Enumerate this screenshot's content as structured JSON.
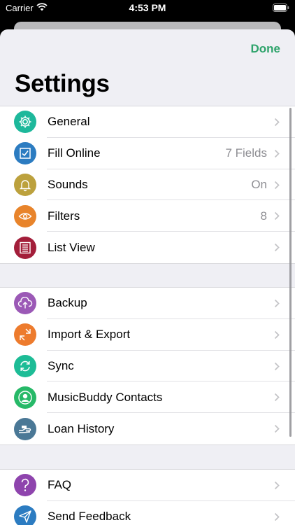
{
  "status_bar": {
    "carrier": "Carrier",
    "time": "4:53 PM"
  },
  "header": {
    "done_label": "Done",
    "title": "Settings"
  },
  "colors": {
    "accent": "#2ea36b"
  },
  "groups": [
    {
      "rows": [
        {
          "label": "General",
          "value": "",
          "icon": "gear-icon",
          "color": "#1db89b"
        },
        {
          "label": "Fill Online",
          "value": "7 Fields",
          "icon": "checkbox-icon",
          "color": "#2c7cc1"
        },
        {
          "label": "Sounds",
          "value": "On",
          "icon": "bell-icon",
          "color": "#bca13d"
        },
        {
          "label": "Filters",
          "value": "8",
          "icon": "eye-icon",
          "color": "#e8842b"
        },
        {
          "label": "List View",
          "value": "",
          "icon": "list-icon",
          "color": "#a31e3a"
        }
      ]
    },
    {
      "rows": [
        {
          "label": "Backup",
          "value": "",
          "icon": "cloud-upload-icon",
          "color": "#9b59b6"
        },
        {
          "label": "Import & Export",
          "value": "",
          "icon": "import-export-icon",
          "color": "#ed7b2d"
        },
        {
          "label": "Sync",
          "value": "",
          "icon": "sync-icon",
          "color": "#1dbc96"
        },
        {
          "label": "MusicBuddy Contacts",
          "value": "",
          "icon": "contact-icon",
          "color": "#27b968"
        },
        {
          "label": "Loan History",
          "value": "",
          "icon": "loan-hand-icon",
          "color": "#4a7896"
        }
      ]
    },
    {
      "rows": [
        {
          "label": "FAQ",
          "value": "",
          "icon": "question-icon",
          "color": "#8e44ad"
        },
        {
          "label": "Send Feedback",
          "value": "",
          "icon": "paper-plane-icon",
          "color": "#2c7cc1"
        }
      ]
    }
  ]
}
